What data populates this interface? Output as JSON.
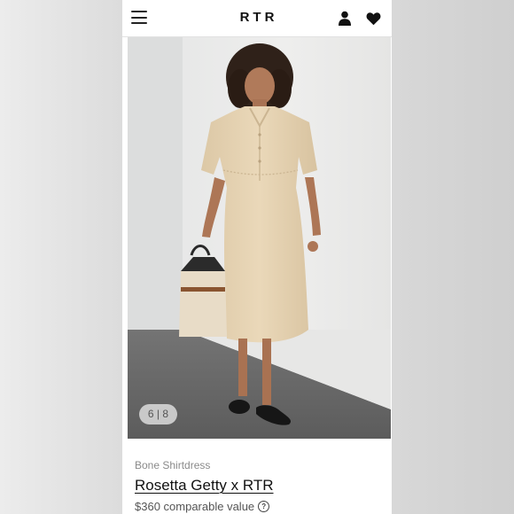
{
  "header": {
    "logo": "RTR",
    "icons": [
      "menu-icon",
      "user-icon",
      "heart-icon"
    ]
  },
  "gallery": {
    "counter": "6 | 8",
    "image_description": "Model wearing a beige short-sleeve midi shirtdress, holding a tote bag, black flats"
  },
  "product": {
    "subtitle": "Bone Shirtdress",
    "title": "Rosetta Getty x RTR",
    "price": "$360 comparable value",
    "help_icon": "?"
  },
  "colors": {
    "dress": "#e6d3b3",
    "wall": "#e9e9e8",
    "floor": "#6f6f6f",
    "text_primary": "#111111",
    "text_secondary": "#8a8a8a"
  }
}
